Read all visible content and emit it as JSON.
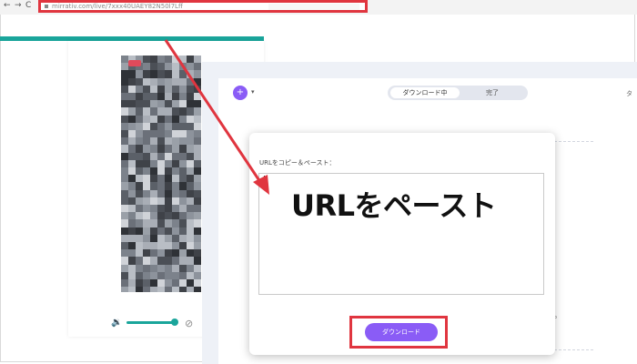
{
  "browser": {
    "back_icon": "←",
    "forward_icon": "→",
    "reload_icon": "C",
    "url": "mirrativ.com/live/7xxx40UAEY82N50l7Lff"
  },
  "app": {
    "tabs": {
      "downloading": "ダウンロード中",
      "done": "完了"
    },
    "top_right": "タ"
  },
  "dialog": {
    "label": "URLをコピー＆ペースト：",
    "overlay_text": "URLをペースト",
    "download_button": "ダウンロード"
  },
  "colors": {
    "highlight_red": "#e0353f",
    "accent_purple": "#8a5cf6",
    "teal": "#1aa59b"
  }
}
